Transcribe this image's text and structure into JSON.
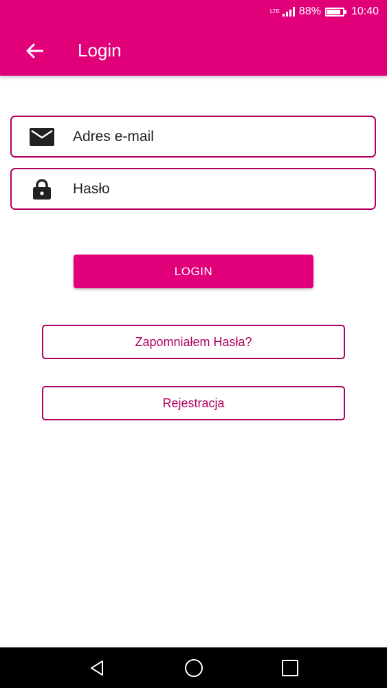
{
  "status_bar": {
    "network": "LTE",
    "battery_percent": "88%",
    "time": "10:40",
    "icons": [
      "lte-icon",
      "signal-icon",
      "battery-icon"
    ]
  },
  "app_bar": {
    "title": "Login",
    "back_icon": "arrow-left-icon"
  },
  "form": {
    "email": {
      "placeholder": "Adres e-mail",
      "icon": "envelope-icon"
    },
    "password": {
      "placeholder": "Hasło",
      "icon": "lock-icon"
    },
    "login_label": "LOGIN",
    "forgot_label": "Zapomniałem Hasła?",
    "register_label": "Rejestracja"
  },
  "nav_bar": {
    "icons": [
      "nav-back-icon",
      "nav-home-icon",
      "nav-recent-icon"
    ]
  },
  "colors": {
    "primary": "#e2007a",
    "outline": "#b0005f",
    "background": "#ffffff",
    "nav_bar": "#000000"
  }
}
